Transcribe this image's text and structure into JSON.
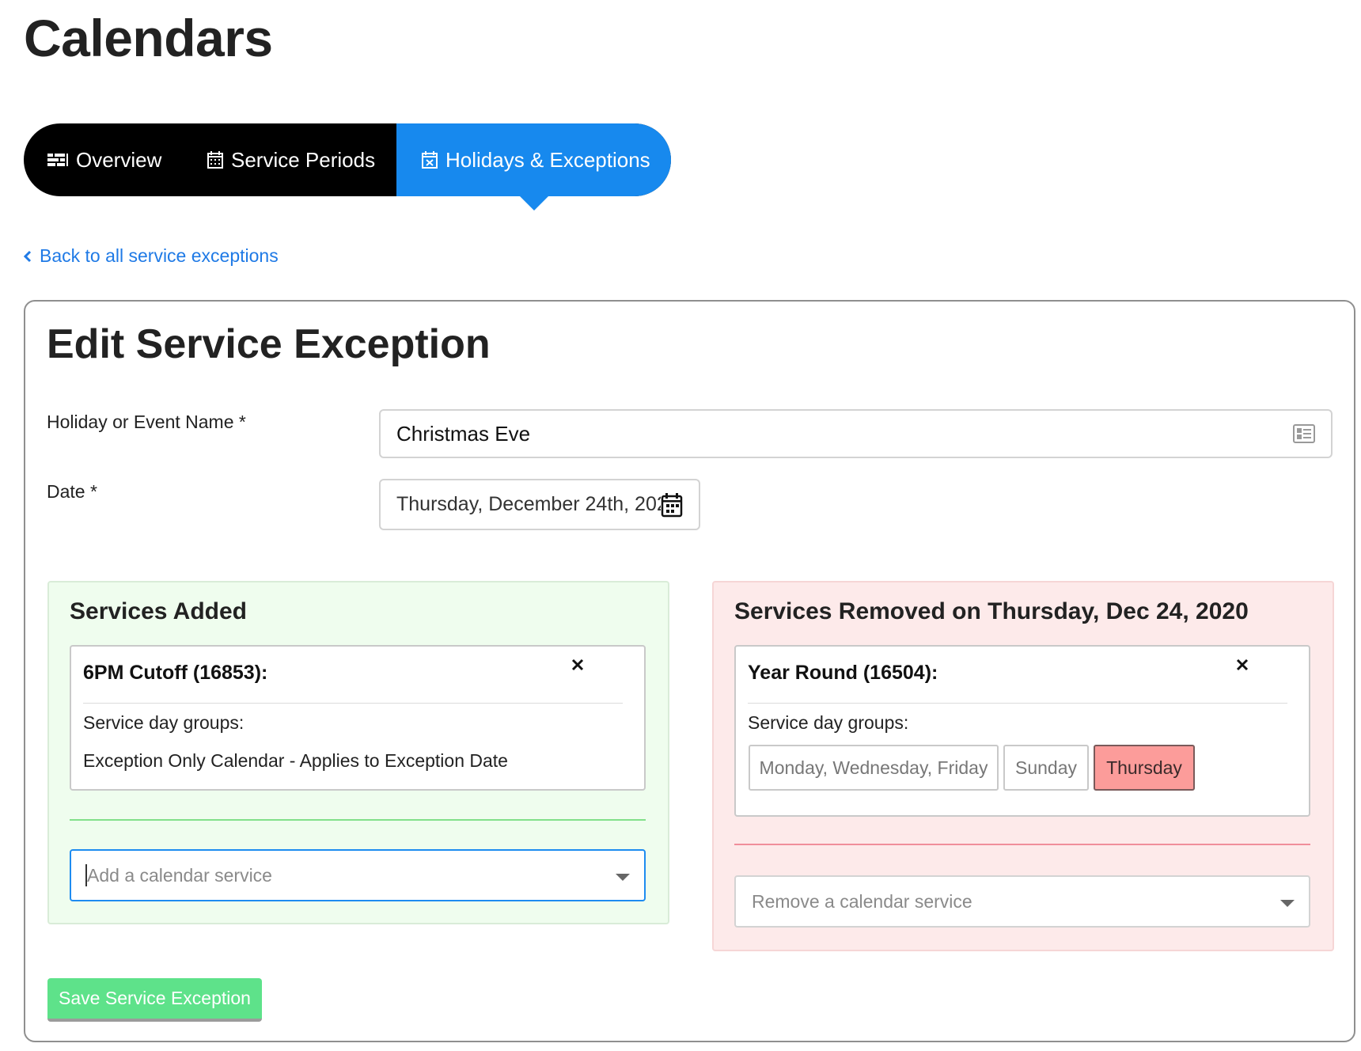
{
  "page": {
    "title": "Calendars"
  },
  "tabs": {
    "overview": "Overview",
    "service_periods": "Service Periods",
    "holidays": "Holidays & Exceptions",
    "active": "holidays"
  },
  "back_link": "Back to all service exceptions",
  "form": {
    "title": "Edit Service Exception",
    "name_label": "Holiday or Event Name *",
    "name_value": "Christmas Eve",
    "date_label": "Date *",
    "date_value": "Thursday, December 24th, 2020"
  },
  "added": {
    "title": "Services Added",
    "service": {
      "name": "6PM Cutoff (16853):",
      "groups_label": "Service day groups:",
      "groups_text": "Exception Only Calendar - Applies to Exception Date"
    },
    "select_placeholder": "Add a calendar service"
  },
  "removed": {
    "title": "Services Removed on Thursday, Dec 24, 2020",
    "service": {
      "name": "Year Round (16504):",
      "groups_label": "Service day groups:",
      "day_groups": [
        "Monday, Wednesday, Friday",
        "Sunday",
        "Thursday"
      ],
      "selected_day_group": "Thursday"
    },
    "select_placeholder": "Remove a calendar service"
  },
  "save_button": "Save Service Exception",
  "colors": {
    "accent": "#1789ee",
    "added_panel_bg": "#effdee",
    "removed_panel_bg": "#fdeaea",
    "selected_chip": "#fc9c9a",
    "save_button": "#5ee28a"
  },
  "icons": {
    "overview": "list-icon",
    "service_periods": "calendar-grid-icon",
    "holidays": "calendar-x-icon",
    "back": "chevron-left-icon",
    "name_field": "id-card-icon",
    "date_field": "calendar-icon",
    "close": "close-icon",
    "select": "caret-down-icon"
  }
}
